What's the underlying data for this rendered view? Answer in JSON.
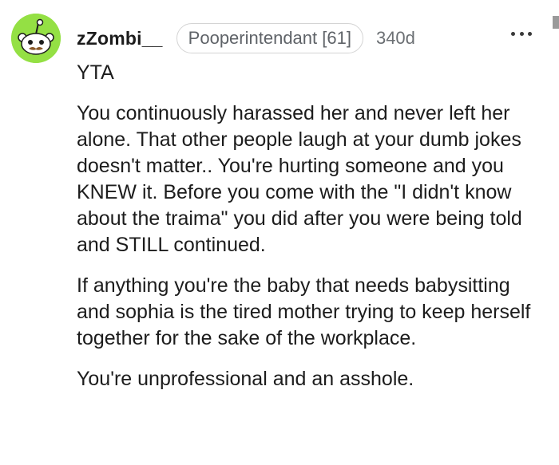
{
  "comment": {
    "username": "zZombi__",
    "flair": "Pooperintendant [61]",
    "age": "340d",
    "more_icon": "more-horizontal-icon",
    "verdict": "YTA",
    "paragraphs": [
      "You continuously harassed her and never left her alone. That other people laugh at your dumb jokes doesn't matter.. You're hurting someone and you KNEW it. Before you come with the \"I didn't know about the traima\" you did after you were being told and STILL continued.",
      "If anything you're the baby that needs babysitting and sophia is the tired mother trying to keep herself together for the sake of the workplace.",
      "You're unprofessional and an asshole."
    ]
  },
  "colors": {
    "avatar_bg": "#94e044",
    "text": "#1c1c1c",
    "meta": "#6b6f73"
  }
}
